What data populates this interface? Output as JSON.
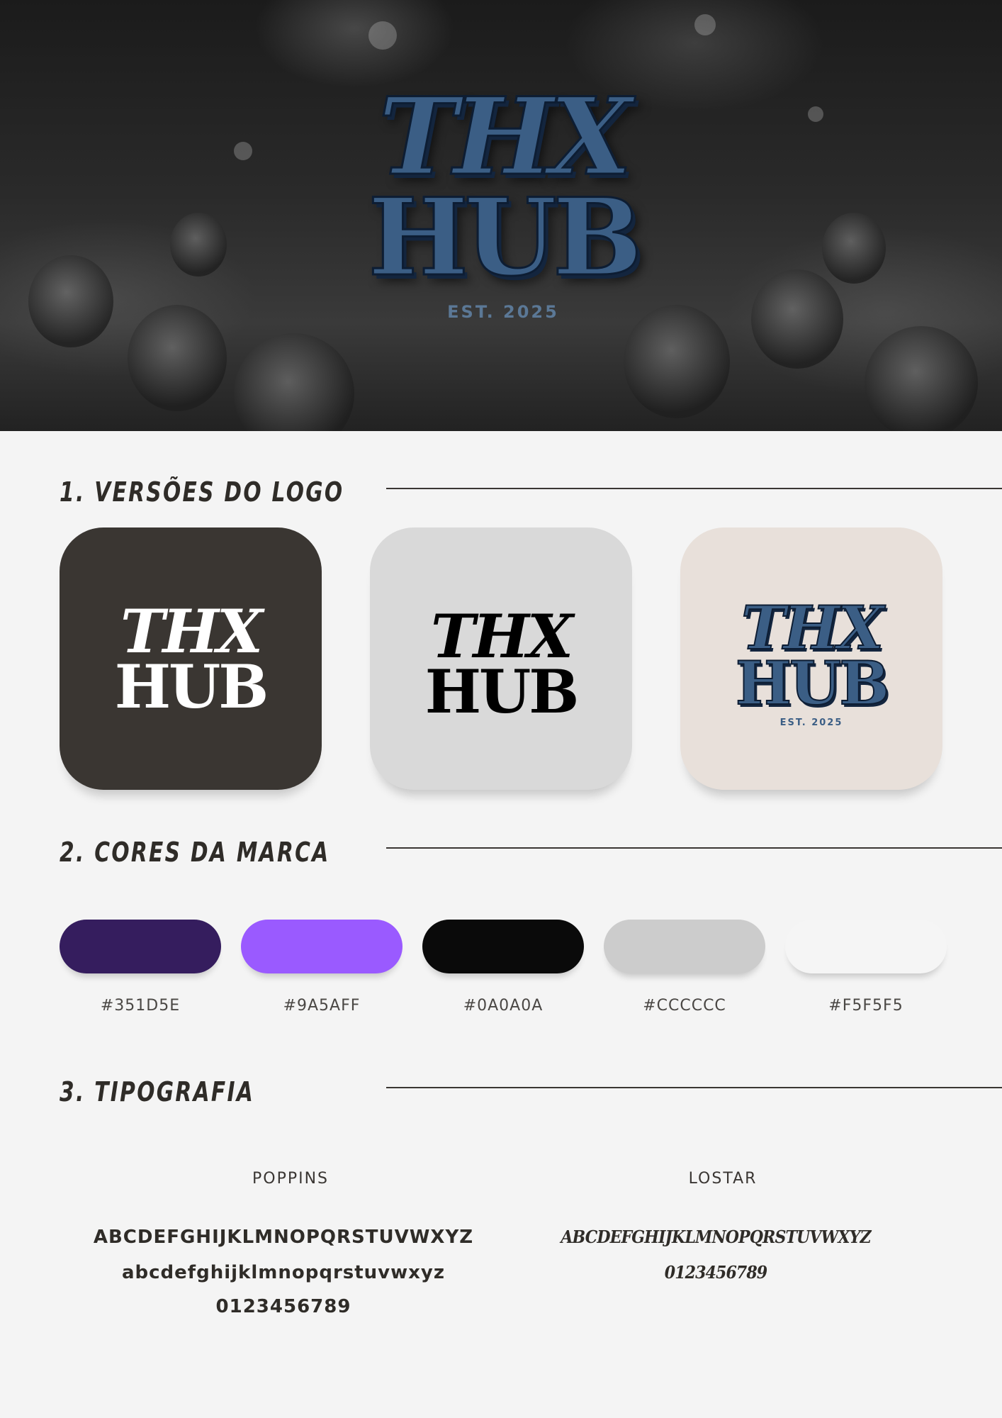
{
  "hero": {
    "logo_line1": "THX",
    "logo_line2": "HUB",
    "est": "EST. 2025"
  },
  "sections": {
    "logos_title": "1. VERSÕES DO LOGO",
    "colors_title": "2. CORES DA MARCA",
    "type_title": "3. TIPOGRAFIA"
  },
  "logo_versions": [
    {
      "line1": "THX",
      "line2": "HUB",
      "background": "#3a3632",
      "ink": "#ffffff"
    },
    {
      "line1": "THX",
      "line2": "HUB",
      "background": "#d9d9d9",
      "ink": "#000000"
    },
    {
      "line1": "THX",
      "line2": "HUB",
      "est": "EST. 2025",
      "background": "#e8e0da",
      "ink": "#3b5e85"
    }
  ],
  "brand_colors": [
    {
      "hex_label": "#351D5E",
      "color": "#351D5E"
    },
    {
      "hex_label": "#9A5AFF",
      "color": "#9A5AFF"
    },
    {
      "hex_label": "#0A0A0A",
      "color": "#0A0A0A"
    },
    {
      "hex_label": "#CCCCCC",
      "color": "#CCCCCC"
    },
    {
      "hex_label": "#F5F5F5",
      "color": "#F5F5F5"
    }
  ],
  "typography": {
    "fonts": [
      {
        "name": "POPPINS",
        "upper": "ABCDEFGHIJKLMNOPQRSTUVWXYZ",
        "lower": "abcdefghijklmnopqrstuvwxyz",
        "digits": "0123456789"
      },
      {
        "name": "LOSTAR",
        "upper": "ABCDEFGHIJKLMNOPQRSTUVWXYZ",
        "digits": "0123456789"
      }
    ]
  }
}
